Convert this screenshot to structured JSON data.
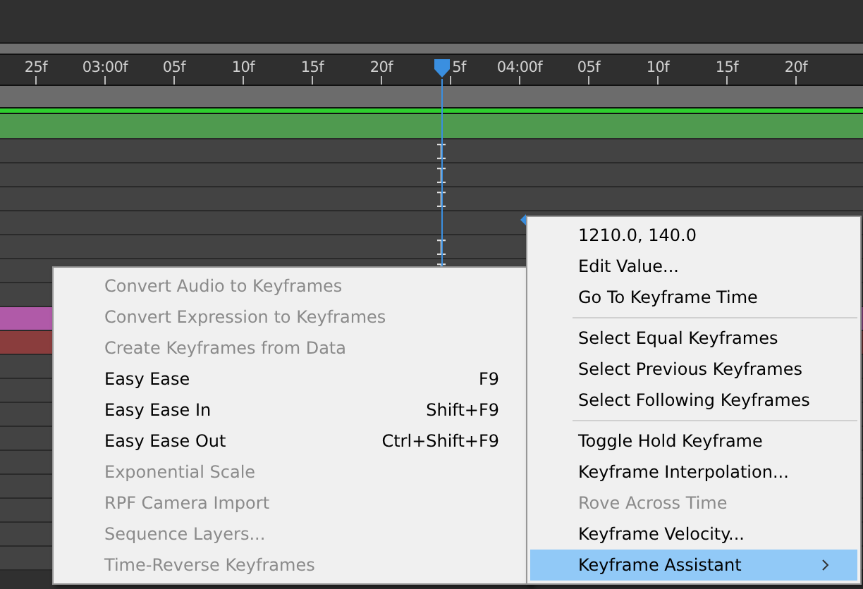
{
  "ruler": {
    "labels": [
      "25f",
      "03:00f",
      "05f",
      "10f",
      "15f",
      "20f",
      "5f",
      "04:00f",
      "05f",
      "10f",
      "15f",
      "20f"
    ]
  },
  "tracks": [
    {
      "color": "#434343",
      "marker": true
    },
    {
      "color": "#434343",
      "marker": true
    },
    {
      "color": "#434343",
      "marker": true
    },
    {
      "color": "#434343",
      "marker": false
    },
    {
      "color": "#434343",
      "marker": true
    },
    {
      "color": "#434343",
      "marker": true
    },
    {
      "color": "#434343",
      "marker": false
    },
    {
      "color": "#b05aa8",
      "marker": false
    },
    {
      "color": "#8a3d3d",
      "marker": false
    },
    {
      "color": "#434343",
      "marker": false
    },
    {
      "color": "#434343",
      "marker": false
    },
    {
      "color": "#434343",
      "marker": false
    },
    {
      "color": "#434343",
      "marker": false
    },
    {
      "color": "#434343",
      "marker": false
    },
    {
      "color": "#434343",
      "marker": false
    },
    {
      "color": "#434343",
      "marker": false
    },
    {
      "color": "#434343",
      "marker": false
    },
    {
      "color": "#434343",
      "marker": false
    }
  ],
  "context_menu": {
    "items": [
      {
        "kind": "item",
        "label": "1210.0, 140.0",
        "disabled": false,
        "selected": false,
        "submenu": false
      },
      {
        "kind": "item",
        "label": "Edit Value...",
        "disabled": false,
        "selected": false,
        "submenu": false
      },
      {
        "kind": "item",
        "label": "Go To Keyframe Time",
        "disabled": false,
        "selected": false,
        "submenu": false
      },
      {
        "kind": "separator"
      },
      {
        "kind": "item",
        "label": "Select Equal Keyframes",
        "disabled": false,
        "selected": false,
        "submenu": false
      },
      {
        "kind": "item",
        "label": "Select Previous Keyframes",
        "disabled": false,
        "selected": false,
        "submenu": false
      },
      {
        "kind": "item",
        "label": "Select Following Keyframes",
        "disabled": false,
        "selected": false,
        "submenu": false
      },
      {
        "kind": "separator"
      },
      {
        "kind": "item",
        "label": "Toggle Hold Keyframe",
        "disabled": false,
        "selected": false,
        "submenu": false
      },
      {
        "kind": "item",
        "label": "Keyframe Interpolation...",
        "disabled": false,
        "selected": false,
        "submenu": false
      },
      {
        "kind": "item",
        "label": "Rove Across Time",
        "disabled": true,
        "selected": false,
        "submenu": false
      },
      {
        "kind": "item",
        "label": "Keyframe Velocity...",
        "disabled": false,
        "selected": false,
        "submenu": false
      },
      {
        "kind": "item",
        "label": "Keyframe Assistant",
        "disabled": false,
        "selected": true,
        "submenu": true
      }
    ]
  },
  "submenu": {
    "items": [
      {
        "label": "Convert Audio to Keyframes",
        "disabled": true
      },
      {
        "label": "Convert Expression to Keyframes",
        "disabled": true
      },
      {
        "label": "Create Keyframes from Data",
        "disabled": true
      },
      {
        "label": "Easy Ease",
        "disabled": false,
        "shortcut": "F9"
      },
      {
        "label": "Easy Ease In",
        "disabled": false,
        "shortcut": "Shift+F9"
      },
      {
        "label": "Easy Ease Out",
        "disabled": false,
        "shortcut": "Ctrl+Shift+F9"
      },
      {
        "label": "Exponential Scale",
        "disabled": true
      },
      {
        "label": "RPF Camera Import",
        "disabled": true
      },
      {
        "label": "Sequence Layers...",
        "disabled": true
      },
      {
        "label": "Time-Reverse Keyframes",
        "disabled": true
      }
    ]
  }
}
